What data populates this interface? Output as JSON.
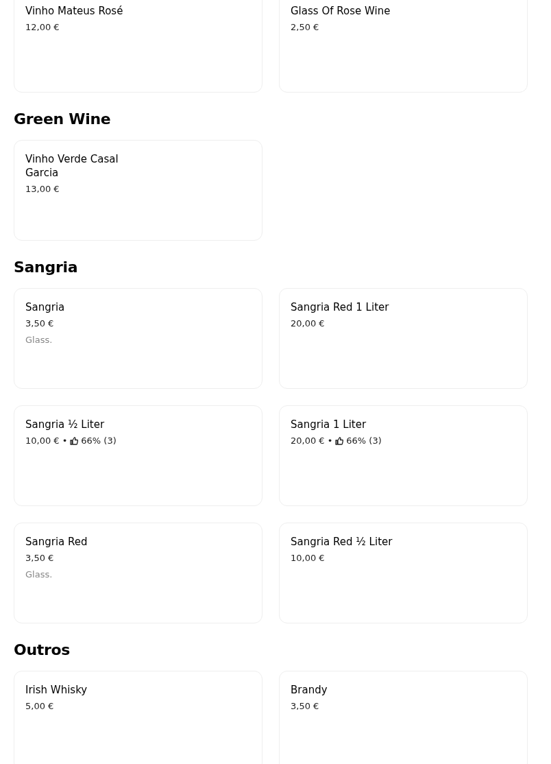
{
  "sections": [
    {
      "items": [
        {
          "name": "Vinho Mateus Rosé",
          "price": "12,00 €"
        },
        {
          "name": "Glass Of Rose Wine",
          "price": "2,50 €"
        }
      ]
    },
    {
      "title": "Green Wine",
      "items": [
        {
          "name": "Vinho Verde Casal Garcia",
          "price": "13,00 €"
        }
      ]
    },
    {
      "title": "Sangria",
      "items": [
        {
          "name": "Sangria",
          "price": "3,50 €",
          "description": "Glass."
        },
        {
          "name": "Sangria Red 1 Liter",
          "price": "20,00 €"
        },
        {
          "name": "Sangria ½ Liter",
          "price": "10,00 €",
          "separator": "•",
          "rating": "66% (3)"
        },
        {
          "name": "Sangria 1 Liter",
          "price": "20,00 €",
          "separator": "•",
          "rating": "66% (3)"
        },
        {
          "name": "Sangria Red",
          "price": "3,50 €",
          "description": "Glass."
        },
        {
          "name": "Sangria Red ½ Liter",
          "price": "10,00 €"
        }
      ]
    },
    {
      "title": "Outros",
      "items": [
        {
          "name": "Irish Whisky",
          "price": "5,00 €"
        },
        {
          "name": "Brandy",
          "price": "3,50 €"
        }
      ]
    }
  ]
}
